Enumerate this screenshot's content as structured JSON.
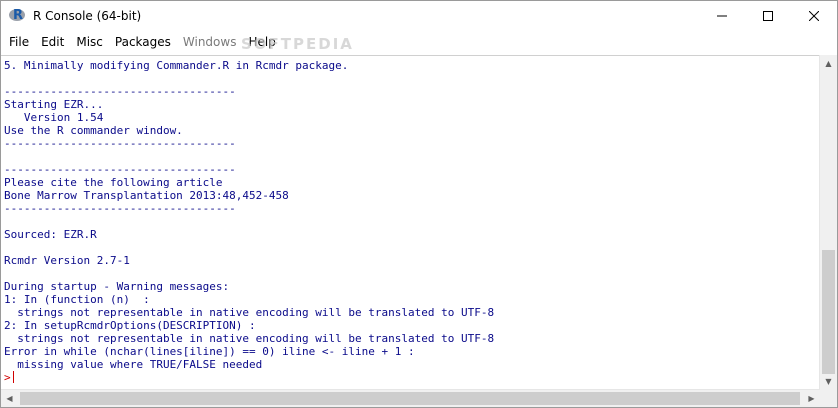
{
  "window": {
    "title": "R Console (64-bit)"
  },
  "icons": {
    "app": "r-logo-icon",
    "minimize": "minimize-icon",
    "maximize": "maximize-icon",
    "close": "close-icon"
  },
  "menu": [
    "File",
    "Edit",
    "Misc",
    "Packages",
    "Windows",
    "Help"
  ],
  "watermark": "SOFTPEDIA",
  "console": {
    "lines": [
      "5. Minimally modifying Commander.R in Rcmdr package.",
      "",
      "-----------------------------------",
      "Starting EZR...",
      "   Version 1.54",
      "Use the R commander window.",
      "-----------------------------------",
      "",
      "-----------------------------------",
      "Please cite the following article",
      "Bone Marrow Transplantation 2013:48,452-458",
      "-----------------------------------",
      "",
      "Sourced: EZR.R",
      "",
      "Rcmdr Version 2.7-1",
      "",
      "During startup - Warning messages:",
      "1: In (function (n)  :",
      "  strings not representable in native encoding will be translated to UTF-8",
      "2: In setupRcmdrOptions(DESCRIPTION) :",
      "  strings not representable in native encoding will be translated to UTF-8",
      "Error in while (nchar(lines[iline]) == 0) iline <- iline + 1 :",
      "  missing value where TRUE/FALSE needed"
    ],
    "prompt": ">"
  },
  "colors": {
    "output": "#0a0a8a",
    "prompt": "#d00000"
  }
}
